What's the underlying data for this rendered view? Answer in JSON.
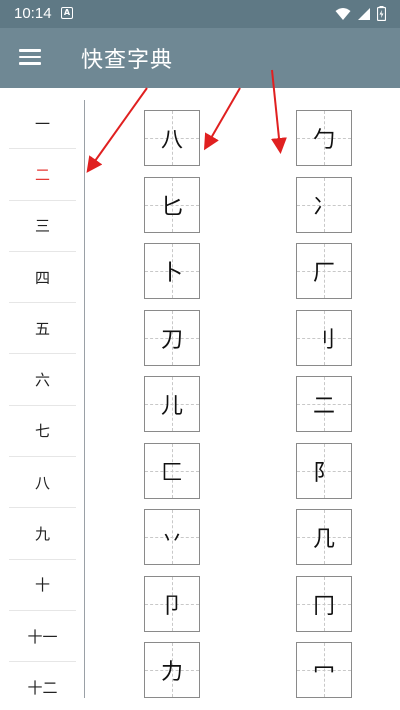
{
  "status_bar": {
    "time": "10:14",
    "notification_glyph": "A",
    "icons": [
      "wifi-icon",
      "signal-icon",
      "battery-charging-icon"
    ]
  },
  "app_bar": {
    "title": "快查字典",
    "menu_icon": "hamburger-menu-icon"
  },
  "stroke_list": {
    "selected_index": 1,
    "items": [
      "一",
      "二",
      "三",
      "四",
      "五",
      "六",
      "七",
      "八",
      "九",
      "十",
      "十一",
      "十二"
    ]
  },
  "characters": {
    "left_column": [
      "八",
      "匕",
      "卜",
      "刀",
      "儿",
      "匚",
      "丷",
      "卩",
      "力"
    ],
    "right_column": [
      "勹",
      "冫",
      "厂",
      "刂",
      "二",
      "阝",
      "几",
      "冂",
      "冖"
    ]
  },
  "colors": {
    "status_bar": "#5f7985",
    "app_bar": "#6f8894",
    "selected_stroke": "#e53935",
    "arrow": "#e02020"
  }
}
